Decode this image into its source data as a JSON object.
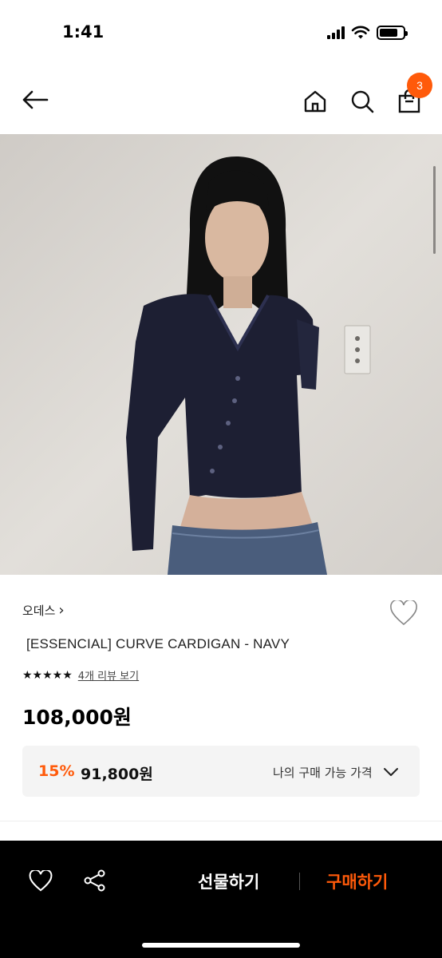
{
  "status_bar": {
    "time": "1:41",
    "battery_level": 0.8
  },
  "nav": {
    "icons": [
      "arrow-left-icon",
      "home-icon",
      "search-icon",
      "shopping-bag-icon"
    ],
    "cart_count": "3"
  },
  "product": {
    "image_desc_icon": "product-photo",
    "brand": "오데스",
    "brand_chevron": "›",
    "title": "[ESSENCIAL] CURVE CARDIGAN - NAVY",
    "stars": "★★★★★",
    "review_link": "4개 리뷰 보기",
    "price": "108,000원",
    "discount": {
      "percent": "15%",
      "price": "91,800원",
      "label": "나의 구매 가능 가격"
    }
  },
  "bottom_bar": {
    "gift_label": "선물하기",
    "buy_label": "구매하기"
  },
  "colors": {
    "accent": "#ff5a0a",
    "bottom_bar_bg": "#000000",
    "discount_box_bg": "#f4f4f4"
  }
}
